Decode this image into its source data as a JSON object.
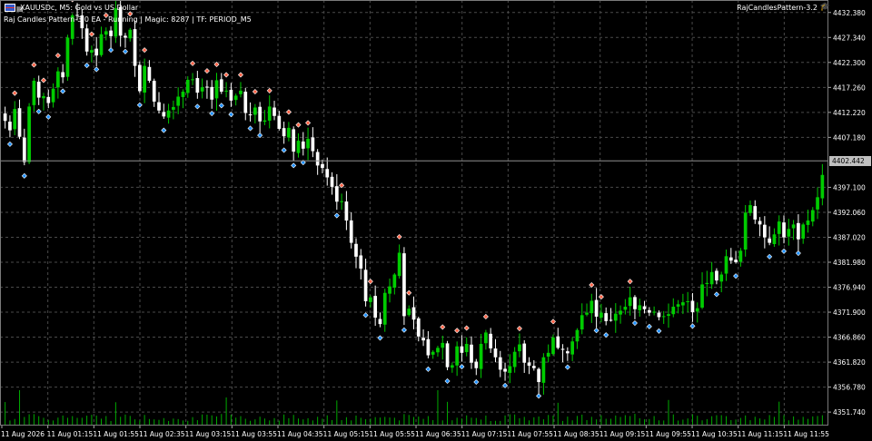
{
  "header": {
    "symbol_line": "XAUUSDc, M5:  Gold vs US Dollar",
    "ea_line": "Raj Candles Pattern-3.0 EA  -  Running | Magic: 8287 | TF: PERIOD_M5",
    "indicator_label": "RajCandlesPattern-3.2"
  },
  "price_axis": {
    "levels": [
      "4432.380",
      "4427.340",
      "4422.300",
      "4417.260",
      "4412.220",
      "4407.180",
      "4397.100",
      "4392.060",
      "4387.020",
      "4381.980",
      "4376.940",
      "4371.900",
      "4366.860",
      "4361.820",
      "4356.780",
      "4351.740"
    ],
    "current_price": "4402.442"
  },
  "time_axis": {
    "labels": [
      "11 Aug 2026",
      "11 Aug 01:15",
      "11 Aug 01:55",
      "11 Aug 02:35",
      "11 Aug 03:15",
      "11 Aug 03:55",
      "11 Aug 04:35",
      "11 Aug 05:15",
      "11 Aug 05:55",
      "11 Aug 06:35",
      "11 Aug 07:15",
      "11 Aug 07:55",
      "11 Aug 08:35",
      "11 Aug 09:15",
      "11 Aug 09:55",
      "11 Aug 10:35",
      "11 Aug 11:15",
      "11 Aug 11:55"
    ]
  },
  "colors": {
    "background": "#000000",
    "grid": "#4a4a4a",
    "bull": "#00cc00",
    "bear": "#ffffff",
    "volume": "#00aa00",
    "buy_marker": "#1e90ff",
    "sell_marker": "#ff6347",
    "current_price_line": "#909090"
  },
  "chart_data": {
    "type": "candlestick",
    "symbol": "XAUUSDc",
    "timeframe": "M5",
    "ylim": [
      4349.2,
      4434.9
    ],
    "closes": [
      4410.5,
      4408.6,
      4412.9,
      4407.3,
      4402.2,
      4413.4,
      4418.6,
      4415.2,
      4415.5,
      4414.1,
      4417.0,
      4420.5,
      4419.3,
      4427.3,
      4431.8,
      4431.8,
      4429.2,
      4424.5,
      4424.8,
      4423.7,
      4428.0,
      4428.6,
      4427.6,
      4433.2,
      4427.7,
      4427.3,
      4428.9,
      4421.6,
      4416.5,
      4421.6,
      4418.6,
      4414.4,
      4412.6,
      4411.4,
      4412.6,
      4413.3,
      4415.4,
      4416.4,
      4418.8,
      4418.9,
      4416.2,
      4417.3,
      4417.4,
      4414.8,
      4418.7,
      4416.4,
      4416.6,
      4414.6,
      4415.6,
      4416.6,
      4412.1,
      4411.8,
      4413.2,
      4410.4,
      4410.6,
      4413.4,
      4411.5,
      4408.9,
      4407.4,
      4409.1,
      4404.3,
      4406.5,
      4404.9,
      4406.9,
      4404.4,
      4401.5,
      4401.0,
      4399.1,
      4397.2,
      4394.2,
      4394.3,
      4390.4,
      4385.9,
      4383.1,
      4380.7,
      4374.1,
      4374.9,
      4370.8,
      4369.5,
      4375.8,
      4377.1,
      4379.5,
      4383.9,
      4371.1,
      4372.6,
      4370.4,
      4367.0,
      4366.2,
      4363.2,
      4363.9,
      4364.7,
      4365.7,
      4360.8,
      4361.2,
      4365.0,
      4363.7,
      4365.5,
      4361.7,
      4360.6,
      4365.5,
      4367.8,
      4364.6,
      4362.8,
      4360.3,
      4359.9,
      4361.0,
      4363.9,
      4365.4,
      4361.7,
      4361.1,
      4360.6,
      4357.8,
      4362.8,
      4363.7,
      4366.8,
      4364.7,
      4364.3,
      4363.6,
      4366.0,
      4368.3,
      4371.3,
      4371.8,
      4374.2,
      4371.0,
      4371.8,
      4370.1,
      4370.3,
      4371.6,
      4372.2,
      4373.0,
      4374.9,
      4372.5,
      4373.3,
      4372.5,
      4371.8,
      4372.0,
      4370.9,
      4371.1,
      4371.5,
      4373.0,
      4373.5,
      4373.9,
      4374.1,
      4371.9,
      4372.7,
      4377.5,
      4377.8,
      4380.0,
      4378.3,
      4379.5,
      4383.2,
      4382.3,
      4382.0,
      4384.3,
      4392.0,
      4393.5,
      4390.6,
      4389.6,
      4387.0,
      4385.9,
      4387.6,
      4390.2,
      4387.0,
      4388.7,
      4389.6,
      4386.6,
      4389.6,
      4390.4,
      4392.5,
      4395.1,
      4399.6
    ],
    "buy_signal_count": 48,
    "sell_signal_count": 33
  }
}
